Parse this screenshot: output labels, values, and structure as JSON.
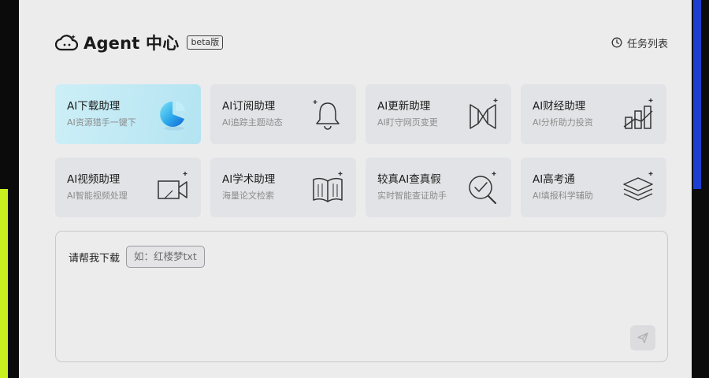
{
  "header": {
    "title": "Agent 中心",
    "badge": "beta版",
    "task_list_label": "任务列表"
  },
  "cards": [
    {
      "title": "AI下载助理",
      "subtitle": "AI资源猎手一键下",
      "icon": "download-orb-icon",
      "active": true
    },
    {
      "title": "AI订阅助理",
      "subtitle": "AI追踪主题动态",
      "icon": "bell-icon"
    },
    {
      "title": "AI更新助理",
      "subtitle": "AI盯守网页变更",
      "icon": "update-window-icon"
    },
    {
      "title": "AI财经助理",
      "subtitle": "AI分析助力投资",
      "icon": "finance-chart-icon"
    },
    {
      "title": "AI视频助理",
      "subtitle": "AI智能视频处理",
      "icon": "video-camera-icon"
    },
    {
      "title": "AI学术助理",
      "subtitle": "海量论文检索",
      "icon": "open-book-icon"
    },
    {
      "title": "较真AI查真假",
      "subtitle": "实时智能查证助手",
      "icon": "magnifier-check-icon"
    },
    {
      "title": "AI高考通",
      "subtitle": "AI填报科学辅助",
      "icon": "graduation-cap-icon"
    }
  ],
  "input": {
    "prompt_label": "请帮我下载",
    "example_placeholder": "如：红楼梦txt"
  },
  "colors": {
    "panel_bg": "#ececed",
    "card_bg": "#e2e3e6",
    "active_card": "#b4e4f2",
    "edge_lime": "#c8f01e",
    "edge_blue": "#1c3fd1"
  }
}
